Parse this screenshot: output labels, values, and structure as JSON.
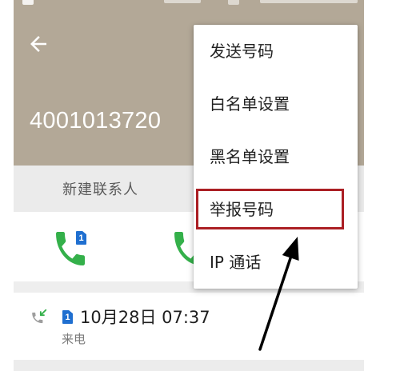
{
  "colors": {
    "header_bg": "#b3a897",
    "tab_bg": "#ebebeb",
    "call_green": "#34b04a",
    "sim_blue": "#1f6fd0",
    "highlight_red": "#ab1f24",
    "annotation_arrow": "#000000"
  },
  "icons": {
    "back": "back-arrow-icon",
    "call": "phone-icon",
    "sim": "sim-card-icon",
    "incoming": "incoming-call-icon",
    "annotation": "annotation-arrow"
  },
  "header": {
    "phone_number": "4001013720"
  },
  "tabs": [
    {
      "label": "新建联系人"
    }
  ],
  "call_actions": [
    {
      "sim": "1"
    }
  ],
  "call_log": [
    {
      "sim": "1",
      "datetime": "10月28日 07:37",
      "type": "来电"
    }
  ],
  "menu": {
    "items": [
      {
        "label": "发送号码"
      },
      {
        "label": "白名单设置"
      },
      {
        "label": "黑名单设置"
      },
      {
        "label": "举报号码",
        "highlighted": true
      },
      {
        "label": "IP 通话"
      }
    ]
  }
}
